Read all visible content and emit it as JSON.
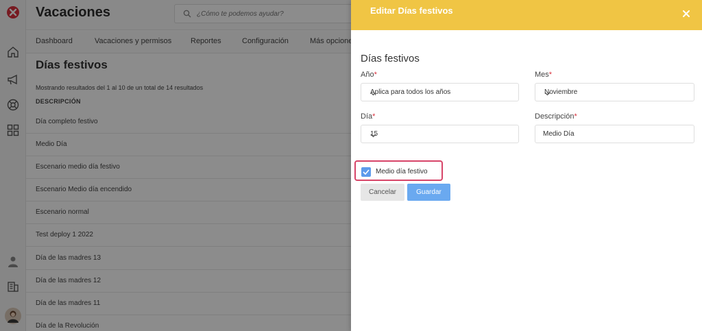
{
  "app": {
    "title": "Vacaciones"
  },
  "search": {
    "placeholder": "¿Cómo te podemos ayudar?"
  },
  "nav": [
    "Dashboard",
    "Vacaciones y permisos",
    "Reportes",
    "Configuración",
    "Más opciones"
  ],
  "main": {
    "title": "Días festivos",
    "results_text": "Mostrando resultados del 1 al 10 de un total de 14 resultados",
    "column_header": "DESCRIPCIÓN",
    "rows": [
      "Día completo festivo",
      "Medio Día",
      "Escenario medio día festivo",
      "Escenario Medio día encendido",
      "Escenario normal",
      "Test deploy 1 2022",
      "Día de las madres 13",
      "Día de las madres 12",
      "Día de las madres 11",
      "Día de la Revolución"
    ]
  },
  "drawer": {
    "title": "Editar Días festivos",
    "section_title": "Días festivos",
    "fields": {
      "year": {
        "label": "Año",
        "value": "Aplica para todos los años"
      },
      "month": {
        "label": "Mes",
        "value": "Noviembre"
      },
      "day": {
        "label": "Día",
        "value": "15"
      },
      "description": {
        "label": "Descripción",
        "value": "Medio Día"
      }
    },
    "required_mark": "*",
    "half_day_label": "Medio día festivo",
    "half_day_checked": true,
    "cancel_label": "Cancelar",
    "save_label": "Guardar"
  },
  "colors": {
    "drawer_header": "#f0c544",
    "primary_button": "#6aa9f0",
    "checkbox": "#5d9bec",
    "highlight": "#d74468",
    "required": "#d9303c",
    "logo": "#d9303c"
  },
  "icons": {
    "rail": [
      "logo-icon",
      "home-icon",
      "megaphone-icon",
      "lifebuoy-icon",
      "grid-icon",
      "user-icon",
      "building-icon",
      "avatar"
    ]
  }
}
